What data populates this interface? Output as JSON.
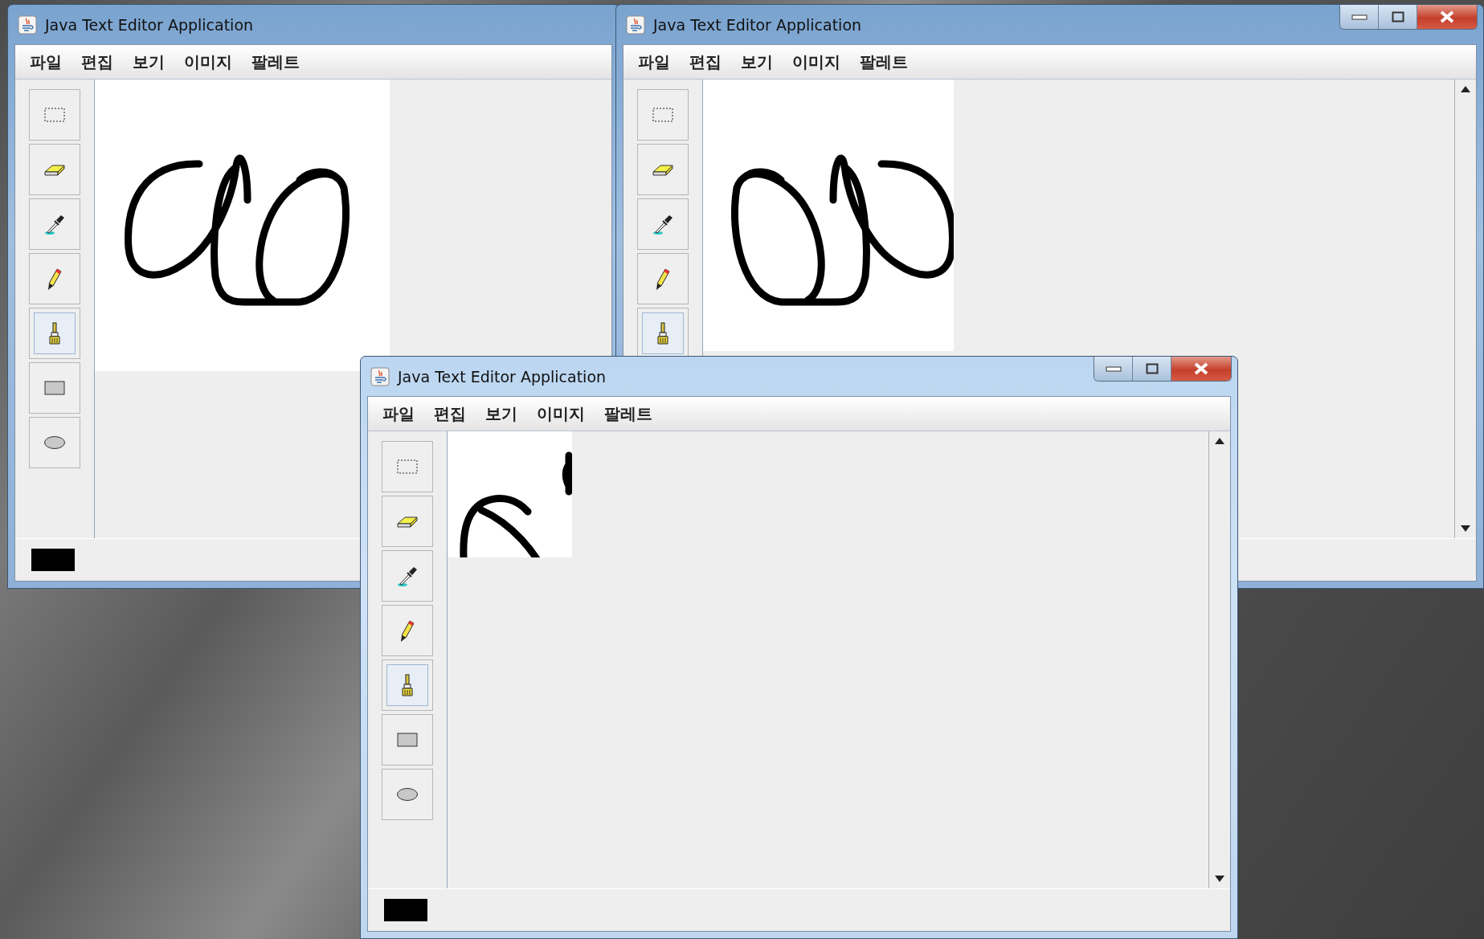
{
  "windows": [
    {
      "title": "Java Text Editor Application",
      "active": false,
      "title_buttons": false,
      "scrollbar": false,
      "color_swatch": true,
      "menu": [
        "파일",
        "편집",
        "보기",
        "이미지",
        "팔레트"
      ],
      "tools": [
        {
          "kind": "select",
          "selected": false
        },
        {
          "kind": "eraser",
          "selected": false
        },
        {
          "kind": "picker",
          "selected": false
        },
        {
          "kind": "pencil",
          "selected": false
        },
        {
          "kind": "brush",
          "selected": true
        },
        {
          "kind": "rect",
          "selected": false
        },
        {
          "kind": "oval",
          "selected": false
        }
      ]
    },
    {
      "title": "Java Text Editor Application",
      "active": false,
      "title_buttons": true,
      "scrollbar": true,
      "color_swatch": false,
      "menu": [
        "파일",
        "편집",
        "보기",
        "이미지",
        "팔레트"
      ],
      "tools": [
        {
          "kind": "select",
          "selected": false
        },
        {
          "kind": "eraser",
          "selected": false
        },
        {
          "kind": "picker",
          "selected": false
        },
        {
          "kind": "pencil",
          "selected": false
        },
        {
          "kind": "brush",
          "selected": true
        }
      ]
    },
    {
      "title": "Java Text Editor Application",
      "active": true,
      "title_buttons": true,
      "scrollbar": true,
      "color_swatch": true,
      "menu": [
        "파일",
        "편집",
        "보기",
        "이미지",
        "팔레트"
      ],
      "tools": [
        {
          "kind": "select",
          "selected": false
        },
        {
          "kind": "eraser",
          "selected": false
        },
        {
          "kind": "picker",
          "selected": false
        },
        {
          "kind": "pencil",
          "selected": false
        },
        {
          "kind": "brush",
          "selected": true
        },
        {
          "kind": "rect",
          "selected": false
        },
        {
          "kind": "oval",
          "selected": false
        }
      ]
    }
  ]
}
